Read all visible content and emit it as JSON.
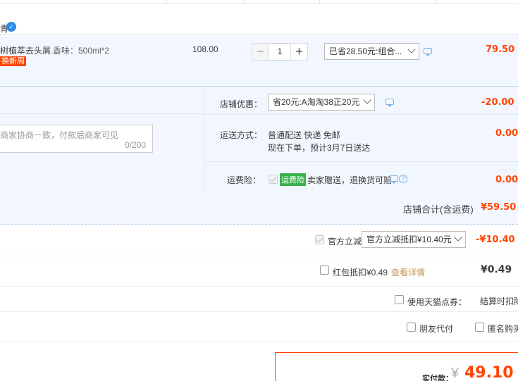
{
  "shop": {
    "name": "青"
  },
  "item": {
    "title": "树植萃去头屑...",
    "spec": "香味：500ml*2",
    "tag": "换新周",
    "unit_price": "108.00",
    "quantity": "1",
    "qty_minus": "−",
    "qty_plus": "+",
    "promo_select": "已省28.50元:组合...",
    "subtotal": "79.50"
  },
  "shop_options": {
    "coupon_label": "店铺优惠：",
    "coupon_select": "省20元:A淘淘38正20元",
    "coupon_value": "-20.00",
    "shipping_label": "运送方式：",
    "shipping_line1": "普通配送 快递 免邮",
    "shipping_line2": "现在下单，预计3月7日送达",
    "shipping_value": "0.00",
    "insurance_label": "运费险：",
    "insurance_tag": "运费险",
    "insurance_text": "卖家赠送，退换货可赔",
    "insurance_value": "0.00",
    "message_placeholder": "商家协商一致，付款后商家可见",
    "message_count": "0/200"
  },
  "shop_total": {
    "label": "店铺合计(含运费)",
    "value": "¥59.50"
  },
  "official_discount": {
    "label": "官方立减",
    "select": "官方立减抵扣¥10.40元",
    "value": "-¥10.40"
  },
  "red_packet": {
    "label": "红包抵扣¥0.49",
    "link": "查看详情",
    "value": "¥0.49"
  },
  "tmall_coupon": {
    "label": "使用天猫点券：",
    "note": "结算时扣除"
  },
  "friend_pay": {
    "label": "朋友代付"
  },
  "anonymous": {
    "label": "匿名购买"
  },
  "payment": {
    "label": "实付款：",
    "currency": "¥",
    "amount": "49.10"
  }
}
